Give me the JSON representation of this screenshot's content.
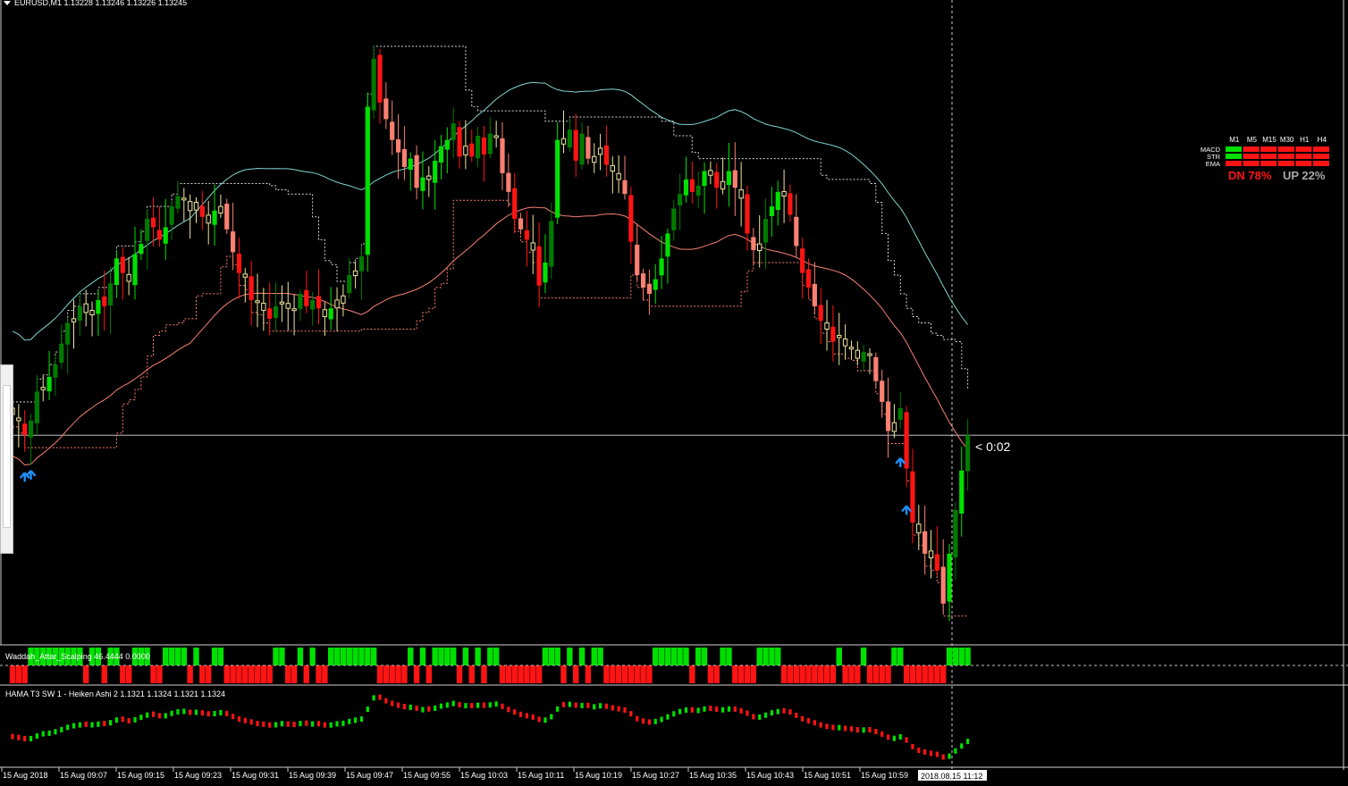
{
  "chart_header": "EURUSD,M1  1.13228 1.13246 1.13226 1.13245",
  "countdown": "< 0:02",
  "time_cursor": "2018.08.15 11:12",
  "colors": {
    "bull": "#00e000",
    "bull_ha": "#007a00",
    "bear": "#ff1414",
    "bear_ha": "#fa8072",
    "doji": "#f0e6a0",
    "upper_band": "#7fd6d0",
    "lower_band": "#fa8072",
    "arrow": "#1e90ff",
    "up_pct": "#a8a8a8"
  },
  "panels": {
    "waddah": {
      "label": "Waddah_Attar_Scalping 46.4444 0.0000"
    },
    "hama": {
      "label": "HAMA T3 SW 1 -  Heiken Ashi 2 1.1321 1.1324 1.1321 1.1324"
    }
  },
  "trend_table": {
    "timeframes": [
      "M1",
      "M5",
      "M15",
      "M30",
      "H1",
      "H4"
    ],
    "rows": [
      {
        "label": "MACD",
        "states": [
          "up",
          "dn",
          "dn",
          "dn",
          "dn",
          "dn"
        ]
      },
      {
        "label": "STR",
        "states": [
          "up",
          "dn",
          "dn",
          "dn",
          "dn",
          "dn"
        ]
      },
      {
        "label": "EMA",
        "states": [
          "dn",
          "dn",
          "dn",
          "dn",
          "dn",
          "dn"
        ]
      }
    ],
    "dn_label": "DN 78%",
    "up_label": "UP 22%"
  },
  "chart_data": {
    "type": "candlestick",
    "symbol": "EURUSD",
    "timeframe": "M1",
    "last_bar": {
      "open": 1.13228,
      "high": 1.13246,
      "low": 1.13226,
      "close": 1.13245
    },
    "x_tick_labels": [
      "15 Aug 2018",
      "15 Aug 09:07",
      "15 Aug 09:15",
      "15 Aug 09:23",
      "15 Aug 09:31",
      "15 Aug 09:39",
      "15 Aug 09:47",
      "15 Aug 09:55",
      "15 Aug 10:03",
      "15 Aug 10:11",
      "15 Aug 10:19",
      "15 Aug 10:27",
      "15 Aug 10:35",
      "15 Aug 10:43",
      "15 Aug 10:51",
      "15 Aug 10:59"
    ],
    "closes": [
      1.13255,
      1.13252,
      1.13245,
      1.13252,
      1.13266,
      1.13268,
      1.13273,
      1.13279,
      1.13289,
      1.13299,
      1.13301,
      1.13307,
      1.13304,
      1.13305,
      1.1331,
      1.13307,
      1.13318,
      1.1333,
      1.13323,
      1.13319,
      1.13332,
      1.13337,
      1.13349,
      1.13345,
      1.13339,
      1.13345,
      1.13355,
      1.1336,
      1.13359,
      1.13353,
      1.13357,
      1.1335,
      1.13347,
      1.13353,
      1.13355,
      1.13344,
      1.13333,
      1.13323,
      1.13321,
      1.1331,
      1.13309,
      1.13305,
      1.13301,
      1.13307,
      1.13309,
      1.13306,
      1.13305,
      1.13313,
      1.13307,
      1.1331,
      1.13306,
      1.13302,
      1.13306,
      1.1331,
      1.13312,
      1.13322,
      1.13324,
      1.13331,
      1.13403,
      1.13426,
      1.13405,
      1.13397,
      1.13387,
      1.13381,
      1.13374,
      1.13378,
      1.13364,
      1.13369,
      1.13368,
      1.13377,
      1.13384,
      1.13387,
      1.13395,
      1.13379,
      1.13384,
      1.13379,
      1.13389,
      1.1338,
      1.1339,
      1.13389,
      1.13371,
      1.13362,
      1.13349,
      1.13344,
      1.13339,
      1.13334,
      1.13317,
      1.13328,
      1.13348,
      1.13387,
      1.13385,
      1.13392,
      1.13377,
      1.1339,
      1.13378,
      1.13379,
      1.13383,
      1.13375,
      1.13372,
      1.13368,
      1.13361,
      1.13338,
      1.13322,
      1.13316,
      1.13313,
      1.1332,
      1.1333,
      1.13342,
      1.13354,
      1.13361,
      1.13368,
      1.13362,
      1.13365,
      1.13372,
      1.1337,
      1.13364,
      1.13367,
      1.13372,
      1.13364,
      1.13359,
      1.13342,
      1.13334,
      1.13337,
      1.13349,
      1.13355,
      1.13362,
      1.1336,
      1.13351,
      1.13336,
      1.13323,
      1.13316,
      1.13307,
      1.133,
      1.13296,
      1.1329,
      1.13293,
      1.13288,
      1.13287,
      1.13282,
      1.13285,
      1.13284,
      1.13271,
      1.13261,
      1.13247,
      1.13251,
      1.13258,
      1.13229,
      1.13203,
      1.13198,
      1.13188,
      1.13186,
      1.1318,
      1.13164,
      1.13188,
      1.13209,
      1.13228,
      1.13245
    ],
    "arrows": [
      {
        "type": "buy",
        "time_label": "15 Aug 2018"
      },
      {
        "type": "buy",
        "time_label": "15 Aug 10:59"
      }
    ]
  }
}
